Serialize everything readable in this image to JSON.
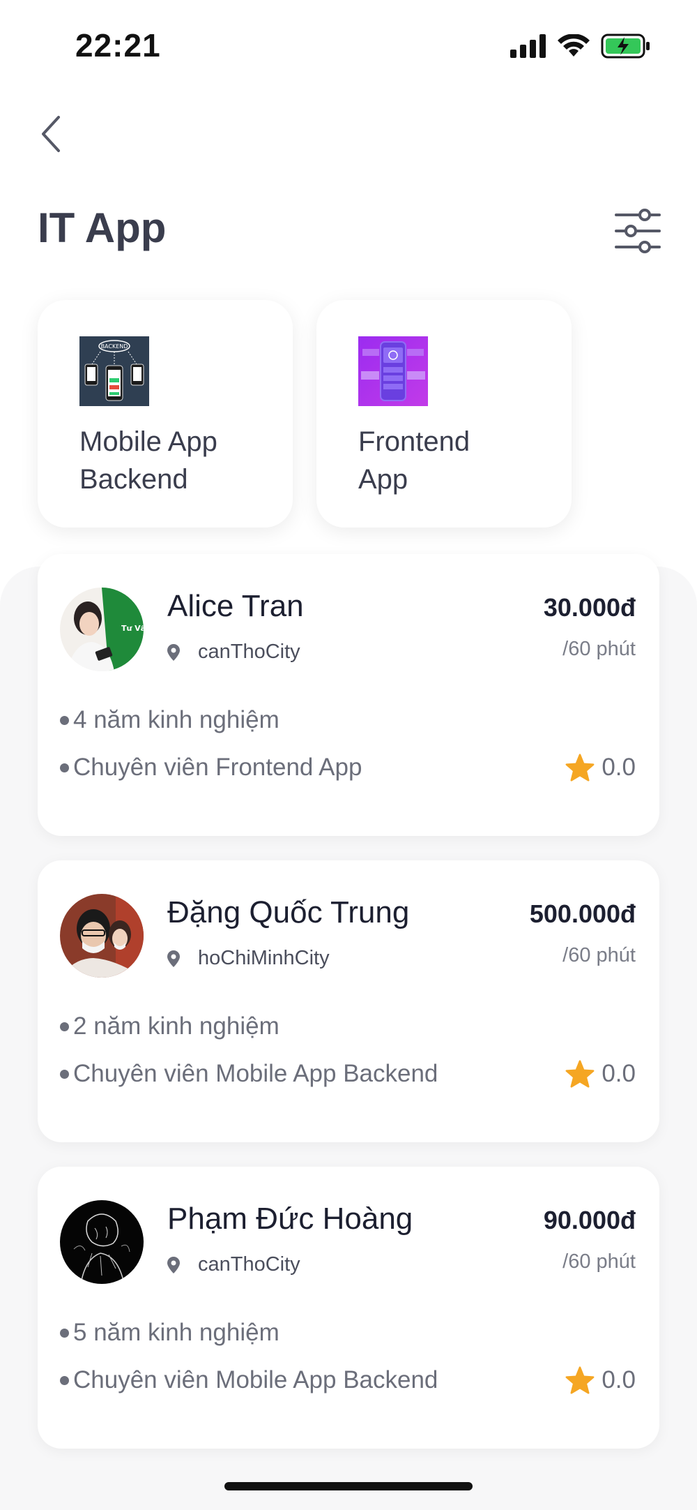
{
  "status_bar": {
    "time": "22:21"
  },
  "header": {
    "title": "IT App"
  },
  "categories": [
    {
      "label": "Mobile App Backend",
      "line1": "Mobile App",
      "line2": "Backend",
      "thumb_text": "BACKEND"
    },
    {
      "label": "Frontend App",
      "line1": "Frontend",
      "line2": "App"
    }
  ],
  "experts": [
    {
      "name": "Alice Tran",
      "location": "canThoCity",
      "price": "30.000đ",
      "per": "/60 phút",
      "experience": "4 năm kinh nghiệm",
      "specialty": "Chuyên viên Frontend App",
      "rating": "0.0",
      "avatar_text": "Tư Vấn"
    },
    {
      "name": "Đặng Quốc Trung",
      "location": "hoChiMinhCity",
      "price": "500.000đ",
      "per": "/60 phút",
      "experience": "2 năm kinh nghiệm",
      "specialty": "Chuyên viên Mobile App Backend",
      "rating": "0.0"
    },
    {
      "name": "Phạm Đức Hoàng",
      "location": "canThoCity",
      "price": "90.000đ",
      "per": "/60 phút",
      "experience": "5 năm kinh nghiệm",
      "specialty": "Chuyên viên Mobile App Backend",
      "rating": "0.0"
    }
  ],
  "icons": {
    "back": "chevron-left-icon",
    "filter": "sliders-icon",
    "location": "map-pin-icon",
    "rating": "star-icon"
  },
  "colors": {
    "accent_star": "#f5a623",
    "battery": "#34c759",
    "title_text": "#3a3d4d"
  }
}
